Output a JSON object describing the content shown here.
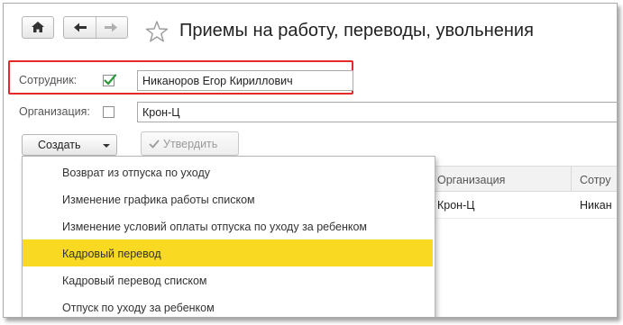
{
  "header": {
    "title": "Приемы на работу, переводы, увольнения",
    "home_icon": "home-icon",
    "back_icon": "arrow-left-icon",
    "forward_icon": "arrow-right-icon",
    "favorite_icon": "star-icon"
  },
  "filters": {
    "employee": {
      "label": "Сотрудник:",
      "checked": true,
      "value": "Никаноров Егор Кириллович"
    },
    "organization": {
      "label": "Организация:",
      "checked": false,
      "value": "Крон-Ц"
    }
  },
  "toolbar": {
    "create_label": "Создать",
    "approve_label": "Утвердить"
  },
  "create_menu": {
    "items": [
      {
        "label": "Возврат из отпуска по уходу"
      },
      {
        "label": "Изменение графика работы списком"
      },
      {
        "label": "Изменение условий оплаты отпуска по уходу за ребенком"
      },
      {
        "label": "Кадровый перевод"
      },
      {
        "label": "Кадровый перевод списком"
      },
      {
        "label": "Отпуск по уходу за ребенком"
      }
    ],
    "selected_index": 3
  },
  "table": {
    "columns": [
      "Организация",
      "Сотру"
    ],
    "rows": [
      [
        "Крон-Ц",
        "Никан"
      ]
    ]
  },
  "colors": {
    "highlight_border": "#e52929",
    "selected_item": "#f9d921",
    "checkbox_green": "#2a9a3a"
  }
}
